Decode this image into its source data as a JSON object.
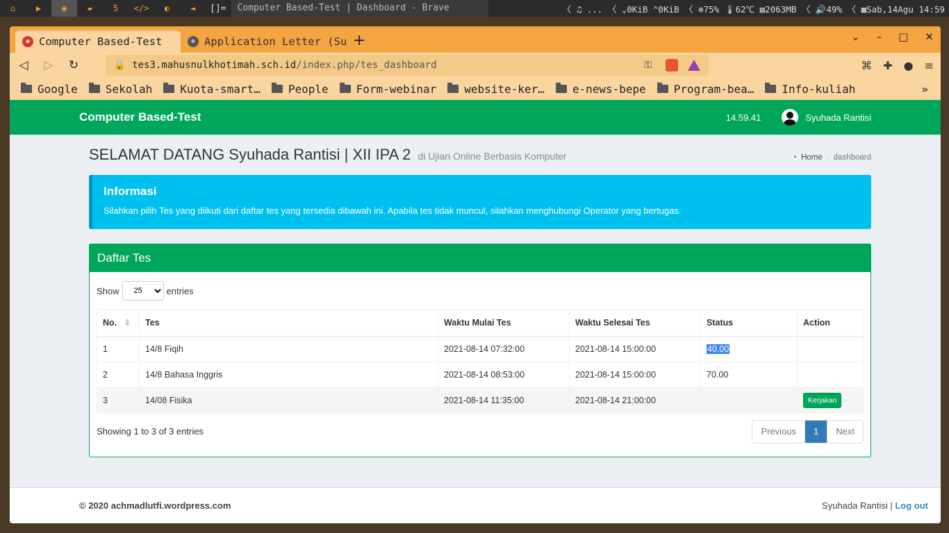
{
  "system_bar": {
    "workspaces": [
      "⌂",
      "▶",
      "◉",
      "▰",
      "5",
      "</>",
      "◐",
      "◄"
    ],
    "layout": "[]=",
    "window_title": "Computer Based-Test | Dashboard - Brave",
    "status": "〈 ♫  ...  〈 ⌄0KiB ⌃0KiB 〈 ⊕75% 🌡62℃ ▤2063MB 〈 🔊49% 〈 ▦Sab,14Agu 14:59"
  },
  "browser": {
    "tabs": [
      {
        "label": "Computer Based-Test",
        "active": true
      },
      {
        "label": "Application Letter (Su",
        "active": false
      }
    ],
    "new_tab": "+",
    "url_host": "tes3.mahusnulkhotimah.sch.id",
    "url_path": "/index.php/tes_dashboard",
    "bookmarks": [
      "Google",
      "Sekolah",
      "Kuota-smart…",
      "People",
      "Form-webinar",
      "website-ker…",
      "e-news-bepe",
      "Program-bea…",
      "Info-kuliah"
    ],
    "bookmarks_more": "»"
  },
  "app": {
    "brand": "Computer Based-Test",
    "clock": "14.59.41",
    "user_name": "Syuhada Rantisi"
  },
  "header": {
    "title": "SELAMAT DATANG Syuhada Rantisi | XII IPA 2",
    "subtitle": "di Ujian Online Berbasis Komputer",
    "breadcrumb_home": "Home",
    "breadcrumb_current": "dashboard"
  },
  "info": {
    "title": "Informasi",
    "text": "Silahkan pilih Tes yang diikuti dari daftar tes yang tersedia dibawah ini. Apabila tes tidak muncul, silahkan menghubungi Operator yang bertugas."
  },
  "list": {
    "title": "Daftar Tes",
    "show_label": "Show",
    "entries_value": "25",
    "entries_label": "entries",
    "columns": [
      "No.",
      "Tes",
      "Waktu Mulai Tes",
      "Waktu Selesai Tes",
      "Status",
      "Action"
    ],
    "rows": [
      {
        "no": "1",
        "tes": "14/8 Fiqih",
        "mulai": "2021-08-14 07:32:00",
        "selesai": "2021-08-14 15:00:00",
        "status": "40.00",
        "action": ""
      },
      {
        "no": "2",
        "tes": "14/8 Bahasa Inggris",
        "mulai": "2021-08-14 08:53:00",
        "selesai": "2021-08-14 15:00:00",
        "status": "70.00",
        "action": ""
      },
      {
        "no": "3",
        "tes": "14/08 Fisika",
        "mulai": "2021-08-14 11:35:00",
        "selesai": "2021-08-14 21:00:00",
        "status": "",
        "action": "Kerjakan"
      }
    ],
    "info": "Showing 1 to 3 of 3 entries",
    "pager": {
      "previous": "Previous",
      "current": "1",
      "next": "Next"
    }
  },
  "footer": {
    "copyright": "© 2020 achmadlutfi.wordpress.com",
    "user": "Syuhada Rantisi |",
    "logout": "Log out"
  }
}
